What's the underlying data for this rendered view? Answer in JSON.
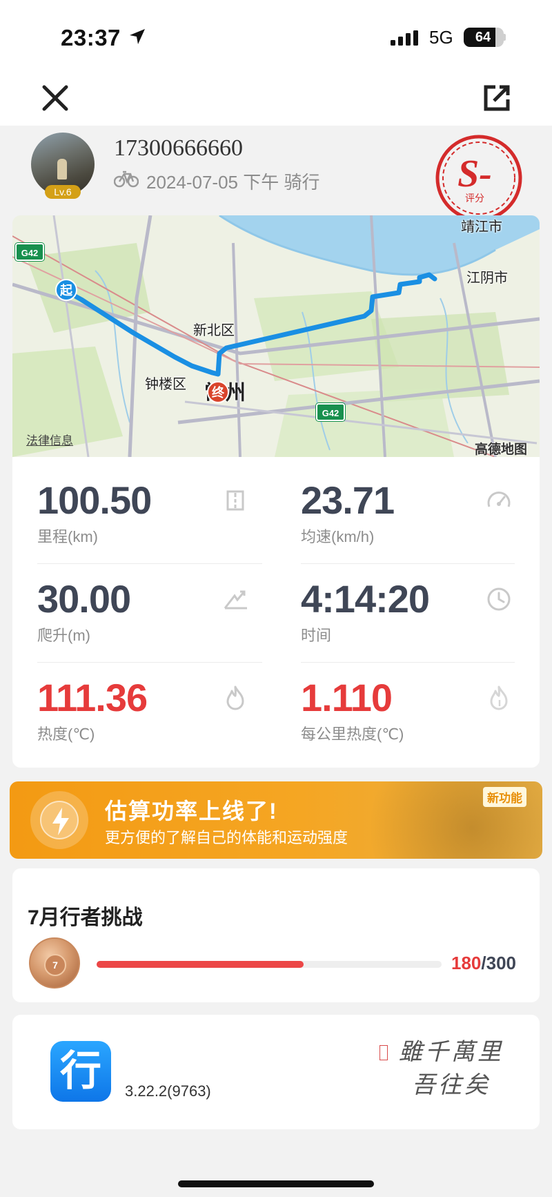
{
  "status_bar": {
    "time": "23:37",
    "network": "5G",
    "battery": "64"
  },
  "nav": {
    "close_icon": "close-icon",
    "share_icon": "share-icon"
  },
  "profile": {
    "user_id": "17300666660",
    "level": "Lv.6",
    "ride_meta": "2024-07-05 下午   骑行",
    "stamp_grade": "S-",
    "stamp_label": "评分"
  },
  "map": {
    "labels": {
      "jingjiang": "靖江市",
      "jiangyin": "江阴市",
      "xinbei": "新北区",
      "zhonglou": "钟楼区",
      "changzhou": "常州"
    },
    "start_pin": "起",
    "end_pin": "终",
    "highway": "G42",
    "legal": "法律信息",
    "brand": "高德地图"
  },
  "stats": [
    {
      "value": "100.50",
      "label": "里程(km)",
      "icon": "road-icon",
      "color": "normal"
    },
    {
      "value": "23.71",
      "label": "均速(km/h)",
      "icon": "speedometer-icon",
      "color": "normal"
    },
    {
      "value": "30.00",
      "label": "爬升(m)",
      "icon": "climb-icon",
      "color": "normal"
    },
    {
      "value": "4:14:20",
      "label": "时间",
      "icon": "clock-icon",
      "color": "normal"
    },
    {
      "value": "111.36",
      "label": "热度(℃)",
      "icon": "flame-icon",
      "color": "red"
    },
    {
      "value": "1.110",
      "label": "每公里热度(℃)",
      "icon": "flame-km-icon",
      "color": "red"
    }
  ],
  "banner": {
    "title": "估算功率上线了!",
    "subtitle": "更方便的了解自己的体能和运动强度",
    "tag": "新功能"
  },
  "challenge": {
    "title": "7月行者挑战",
    "medal_number": "7",
    "current": "180",
    "total": "/300",
    "progress": 0.6
  },
  "footer": {
    "app_glyph": "行",
    "version": "3.22.2(9763)",
    "calligraphy": "雖千萬里 吾往矣"
  },
  "colors": {
    "accent_red": "#e63b3b",
    "route_blue": "#1a8fe3",
    "banner_orange": "#f5a623"
  }
}
